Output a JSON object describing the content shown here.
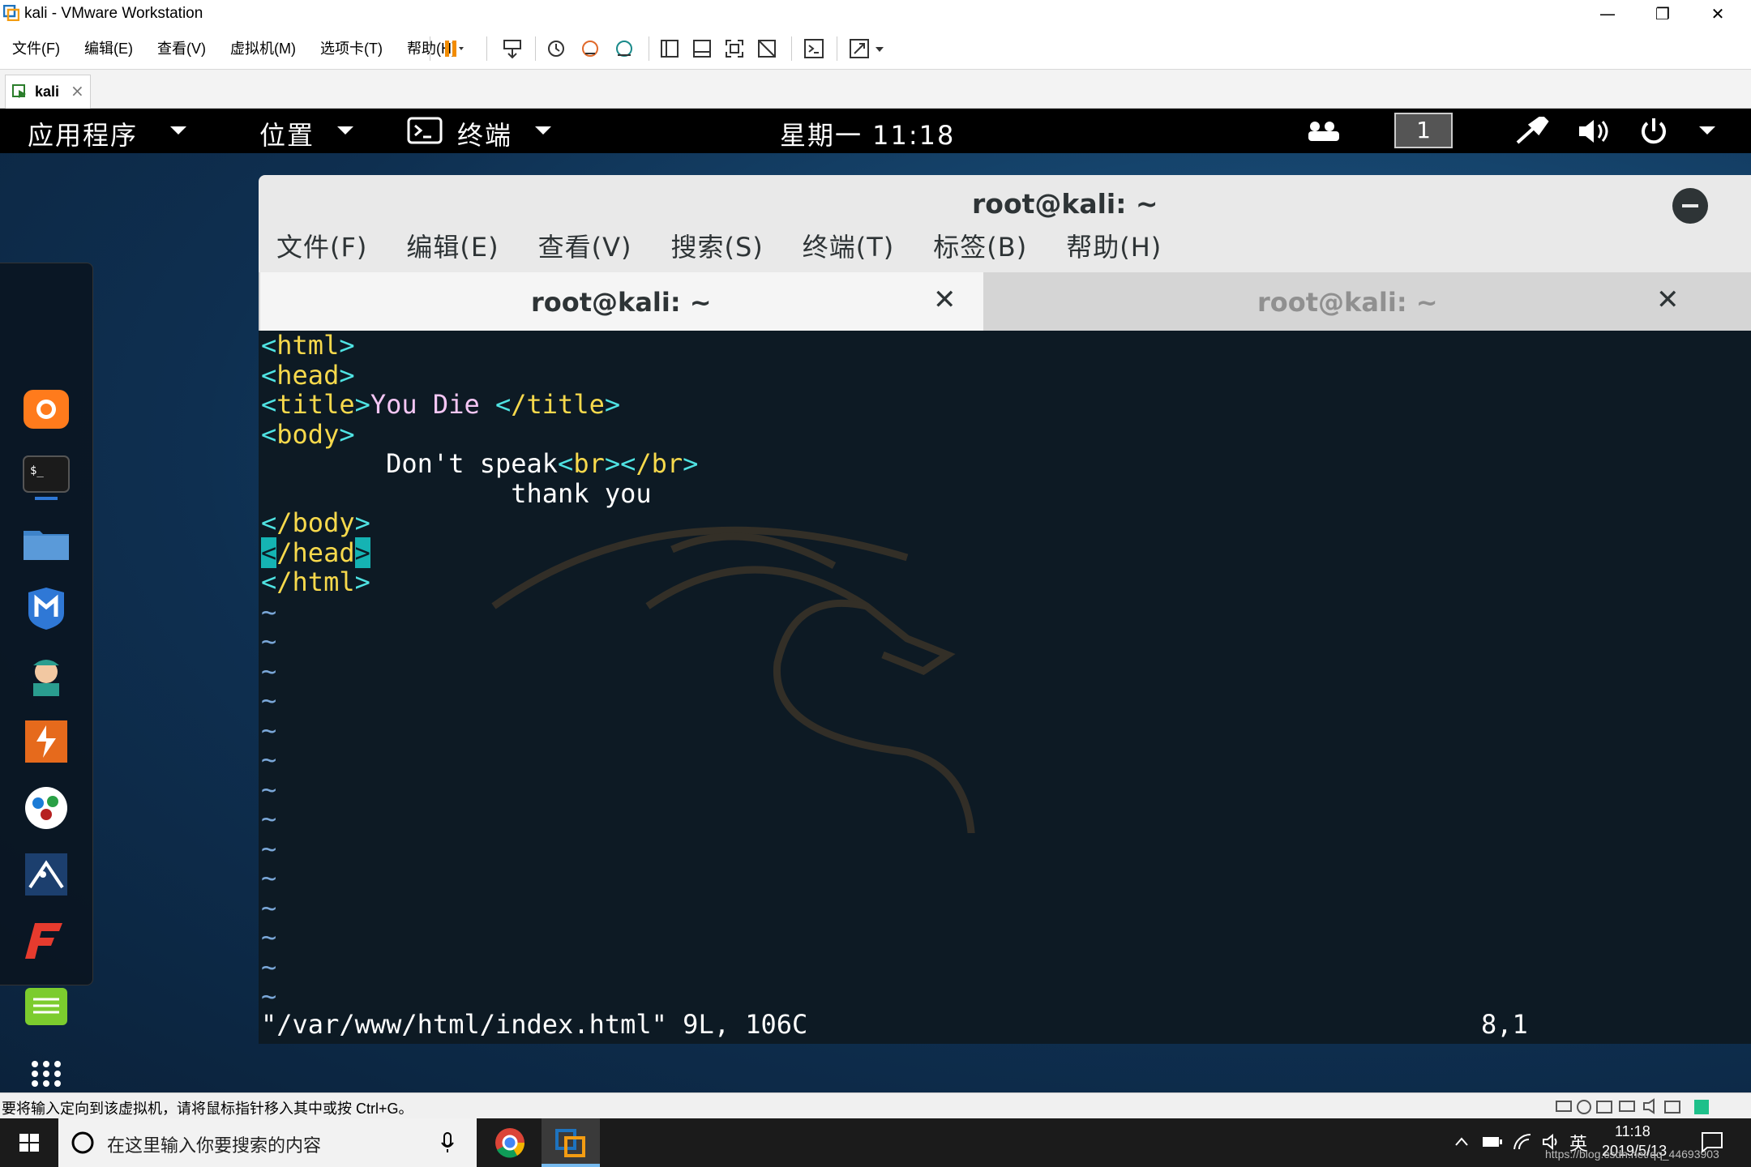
{
  "vmware": {
    "title": "kali - VMware Workstation",
    "menu": [
      "文件(F)",
      "编辑(E)",
      "查看(V)",
      "虚拟机(M)",
      "选项卡(T)",
      "帮助(H)"
    ],
    "tab_label": "kali",
    "status_text": "要将输入定向到该虚拟机，请将鼠标指针移入其中或按 Ctrl+G。"
  },
  "gnome": {
    "applications": "应用程序",
    "places": "位置",
    "terminal_app": "终端",
    "clock": "星期一 11:18",
    "workspace": "1"
  },
  "terminal": {
    "title": "root@kali: ~",
    "menu": [
      "文件(F)",
      "编辑(E)",
      "查看(V)",
      "搜索(S)",
      "终端(T)",
      "标签(B)",
      "帮助(H)"
    ],
    "tabs": [
      {
        "label": "root@kali: ~",
        "active": true
      },
      {
        "label": "root@kali: ~",
        "active": false
      }
    ],
    "status_file": "\"/var/www/html/index.html\" 9L, 106C",
    "cursor_position": "8,1",
    "code": {
      "l1_open": "<",
      "l1_name": "html",
      "l1_close": ">",
      "l2_name": "head",
      "l3_name": "title",
      "l3_text": "You Die ",
      "l3_end": "/title",
      "l4_name": "body",
      "l5_text": "        Don't speak",
      "l5_br": "br",
      "l5_brend": "/br",
      "l6_text": "                thank you",
      "l7_name": "/body",
      "l8_name": "/head",
      "l9_name": "/html",
      "tilde": "~"
    }
  },
  "taskbar": {
    "search_placeholder": "在这里输入你要搜索的内容",
    "ime": "英",
    "time": "11:18",
    "date": "2019/5/13",
    "watermark": "https://blog.csdn.net/qq_44693903"
  }
}
